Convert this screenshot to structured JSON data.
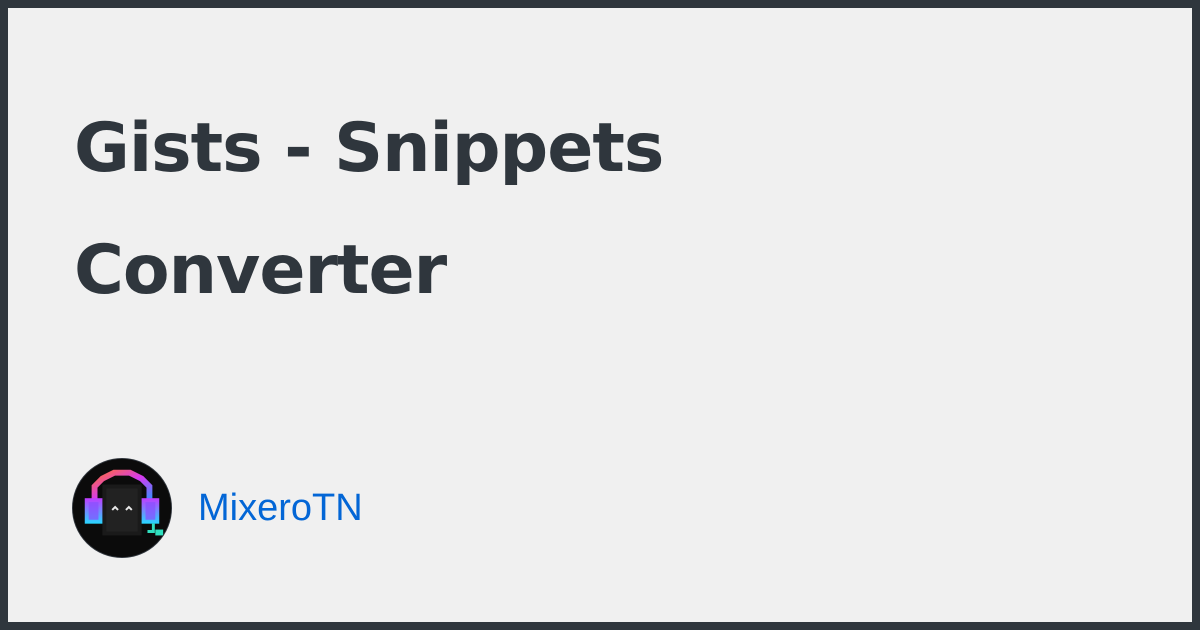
{
  "repo": {
    "title_line1": "Gists - Snippets",
    "title_line2": "Converter"
  },
  "author": {
    "name": "MixeroTN",
    "avatar_icon": "pixel-headphones-character-avatar"
  },
  "colors": {
    "page_border": "#2f363d",
    "background": "#f0f0f0",
    "title_text": "#2f363d",
    "author_link": "#0366d6"
  }
}
